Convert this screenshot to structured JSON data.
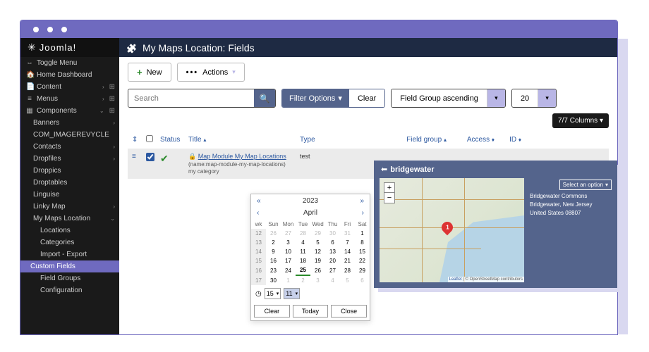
{
  "brand": "Joomla!",
  "page_title": "My Maps Location: Fields",
  "toolbar": {
    "new": "New",
    "actions": "Actions"
  },
  "search": {
    "placeholder": "Search"
  },
  "filters": {
    "filter_options": "Filter Options",
    "clear": "Clear",
    "sort": "Field Group ascending",
    "limit": "20",
    "columns": "7/7 Columns"
  },
  "sidebar": [
    {
      "icon": "⇔",
      "label": "Toggle Menu",
      "level": 1
    },
    {
      "icon": "🏠",
      "label": "Home Dashboard",
      "level": 1
    },
    {
      "icon": "📄",
      "label": "Content",
      "level": 1,
      "chev": "›",
      "plus": true
    },
    {
      "icon": "≡",
      "label": "Menus",
      "level": 1,
      "chev": "›",
      "plus": true
    },
    {
      "icon": "▦",
      "label": "Components",
      "level": 1,
      "chev": "⌄",
      "plus": true
    },
    {
      "label": "Banners",
      "level": 2,
      "chev": "›"
    },
    {
      "label": "COM_IMAGEREVYCLE",
      "level": 2
    },
    {
      "label": "Contacts",
      "level": 2,
      "chev": "›"
    },
    {
      "label": "Dropfiles",
      "level": 2,
      "chev": "›"
    },
    {
      "label": "Droppics",
      "level": 2
    },
    {
      "label": "Droptables",
      "level": 2
    },
    {
      "label": "Linguise",
      "level": 2
    },
    {
      "label": "Linky Map",
      "level": 2,
      "chev": "›"
    },
    {
      "label": "My Maps Location",
      "level": 2,
      "chev": "⌄"
    },
    {
      "label": "Locations",
      "level": 3
    },
    {
      "label": "Categories",
      "level": 3
    },
    {
      "label": "Import - Export",
      "level": 3
    },
    {
      "label": "Custom Fields",
      "level": 3,
      "active": true
    },
    {
      "label": "Field Groups",
      "level": 3
    },
    {
      "label": "Configuration",
      "level": 3
    }
  ],
  "columns": {
    "status": "Status",
    "title": "Title",
    "type": "Type",
    "field_group": "Field group",
    "access": "Access",
    "id": "ID"
  },
  "row": {
    "title": "Map Module My Map Locations",
    "name_line": "(name:map-module-my-map-locations)",
    "category": "my category",
    "type": "test"
  },
  "calendar": {
    "year": "2023",
    "month": "April",
    "days_header": [
      "wk",
      "Sun",
      "Mon",
      "Tue",
      "Wed",
      "Thu",
      "Fri",
      "Sat"
    ],
    "weeks": [
      [
        "12",
        "26",
        "27",
        "28",
        "29",
        "30",
        "31",
        "1"
      ],
      [
        "13",
        "2",
        "3",
        "4",
        "5",
        "6",
        "7",
        "8"
      ],
      [
        "14",
        "9",
        "10",
        "11",
        "12",
        "13",
        "14",
        "15"
      ],
      [
        "15",
        "16",
        "17",
        "18",
        "19",
        "20",
        "21",
        "22"
      ],
      [
        "16",
        "23",
        "24",
        "25",
        "26",
        "27",
        "28",
        "29"
      ],
      [
        "17",
        "30",
        "1",
        "2",
        "3",
        "4",
        "5",
        "6"
      ]
    ],
    "today": "25",
    "hour": "15",
    "minute": "11",
    "clear": "Clear",
    "today_btn": "Today",
    "close": "Close"
  },
  "map": {
    "title": "bridgewater",
    "lines": [
      "Bridgewater Commons",
      "Bridgewater, New Jersey",
      "United States 08807"
    ],
    "select_option": "Select an option",
    "attribution_leaflet": "Leaflet",
    "attribution_osm": "© OpenStreetMap contributors",
    "pin": "1"
  }
}
